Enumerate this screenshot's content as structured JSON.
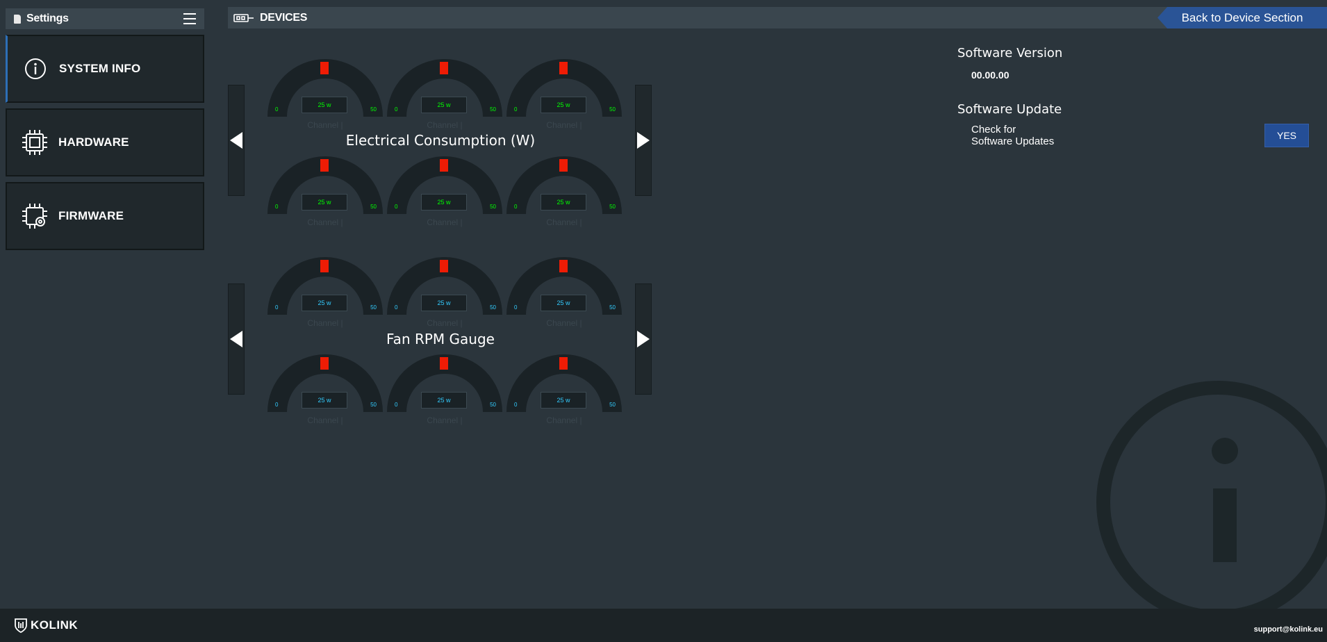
{
  "sidebar": {
    "title": "Settings",
    "items": [
      {
        "label": "SYSTEM INFO",
        "icon": "info-icon"
      },
      {
        "label": "HARDWARE",
        "icon": "chip-icon"
      },
      {
        "label": "FIRMWARE",
        "icon": "chip-gear-icon"
      }
    ]
  },
  "topbar": {
    "title": "DEVICES",
    "back_label": "Back to Device Section"
  },
  "electrical": {
    "title": "Electrical Consumption (W)",
    "value_color": "#00ff00",
    "gauges": [
      {
        "value": "25 w",
        "min": "0",
        "max": "50",
        "channel": "Channel |"
      },
      {
        "value": "25 w",
        "min": "0",
        "max": "50",
        "channel": "Channel |"
      },
      {
        "value": "25 w",
        "min": "0",
        "max": "50",
        "channel": "Channel |"
      },
      {
        "value": "25 w",
        "min": "0",
        "max": "50",
        "channel": "Channel |"
      },
      {
        "value": "25 w",
        "min": "0",
        "max": "50",
        "channel": "Channel |"
      },
      {
        "value": "25 w",
        "min": "0",
        "max": "50",
        "channel": "Channel |"
      }
    ]
  },
  "fan": {
    "title": "Fan RPM Gauge",
    "value_color": "#33ccff",
    "gauges": [
      {
        "value": "25 w",
        "min": "0",
        "max": "50",
        "channel": "Channel |"
      },
      {
        "value": "25 w",
        "min": "0",
        "max": "50",
        "channel": "Channel |"
      },
      {
        "value": "25 w",
        "min": "0",
        "max": "50",
        "channel": "Channel |"
      },
      {
        "value": "25 w",
        "min": "0",
        "max": "50",
        "channel": "Channel |"
      },
      {
        "value": "25 w",
        "min": "0",
        "max": "50",
        "channel": "Channel |"
      },
      {
        "value": "25 w",
        "min": "0",
        "max": "50",
        "channel": "Channel |"
      }
    ]
  },
  "info": {
    "version_heading": "Software Version",
    "version_value": "00.00.00",
    "update_heading": "Software Update",
    "update_line1": "Check for",
    "update_line2": "Software Updates",
    "yes_label": "YES"
  },
  "footer": {
    "brand": "KOLINK",
    "email": "support@kolink.eu"
  },
  "colors": {
    "accent": "#2a5496",
    "needle": "#ee1c05",
    "background": "#2b353c"
  }
}
